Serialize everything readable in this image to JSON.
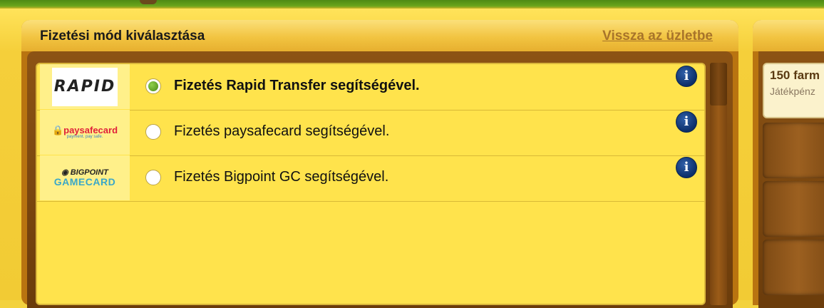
{
  "header": {
    "title": "Fizetési mód kiválasztása",
    "back_link": "Vissza az üzletbe"
  },
  "payment_options": [
    {
      "label": "Fizetés Rapid Transfer segítségével.",
      "selected": true,
      "logo": "rapid-transfer-logo",
      "logo_text": "RAPID"
    },
    {
      "label": "Fizetés paysafecard segítségével.",
      "selected": false,
      "logo": "paysafecard-logo",
      "logo_text": "paysafecard",
      "logo_sub": "payment. pay safe."
    },
    {
      "label": "Fizetés Bigpoint GC segítségével.",
      "selected": false,
      "logo": "bigpoint-gamecard-logo",
      "logo_text": "BIGPOINT",
      "logo_sub": "GAMECARD"
    }
  ],
  "info_icon_glyph": "i",
  "side_offer": {
    "title": "150 farm",
    "subtitle": "Játékpénz"
  },
  "colors": {
    "panel_bg": "#ffe34c",
    "wood": "#8c5314",
    "accent_link": "#a8742a",
    "info_blue": "#0c2f6a"
  }
}
